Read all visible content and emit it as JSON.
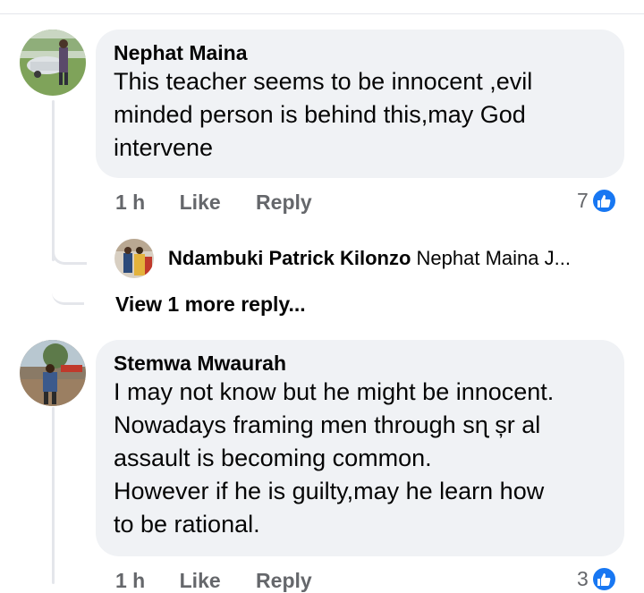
{
  "comments": [
    {
      "author": "Nephat Maina",
      "text_lines": [
        "This teacher seems to be innocent ,evil",
        "minded person is behind this,may God",
        "intervene"
      ],
      "time": "1 h",
      "like_label": "Like",
      "reply_label": "Reply",
      "reaction_count": "7",
      "reaction_icon": "thumbs-up-icon"
    },
    {
      "author": "Stemwa Mwaurah",
      "text_lines": [
        "I may not know but he might be innocent.",
        "Nowadays framing men through sɳ șr al",
        "assault is becoming common.",
        "However if he is guilty,may he learn how",
        "to be rational."
      ],
      "time": "1 h",
      "like_label": "Like",
      "reply_label": "Reply",
      "reaction_count": "3",
      "reaction_icon": "thumbs-up-icon"
    }
  ],
  "reply_preview": {
    "author": "Ndambuki Patrick Kilonzo",
    "text": "Nephat Maina J..."
  },
  "view_more_label": "View 1 more reply...",
  "colors": {
    "bubble": "#f0f2f5",
    "secondary_text": "#65676b",
    "like_blue": "#1877f2",
    "thread_line": "#e4e6eb"
  }
}
